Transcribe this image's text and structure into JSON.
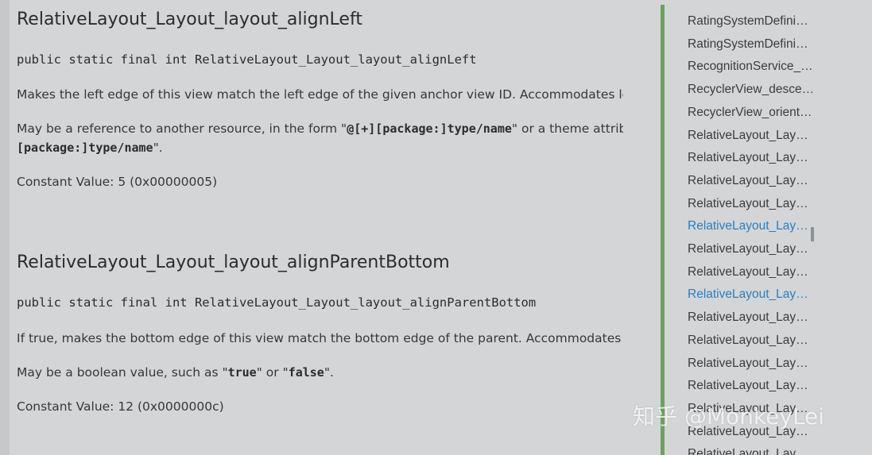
{
  "sections": [
    {
      "title": "RelativeLayout_Layout_layout_alignLeft",
      "signature": "public static final int RelativeLayout_Layout_layout_alignLeft",
      "description": "Makes the left edge of this view match the left edge of the given anchor view ID. Accommodates left margin.",
      "reference_prefix": "May be a reference to another resource, in the form \"",
      "reference_code": "@[+][package:]type/name",
      "reference_suffix": "\" or a theme attribute in the form \"",
      "reference_line2_prefix": "",
      "reference_line2_code": "[package:]type/name",
      "reference_line2_suffix": "\".",
      "constant": "Constant Value: 5 (0x00000005)"
    },
    {
      "title": "RelativeLayout_Layout_layout_alignParentBottom",
      "signature": "public static final int RelativeLayout_Layout_layout_alignParentBottom",
      "description": "If true, makes the bottom edge of this view match the bottom edge of the parent. Accommodates bottom margin.",
      "bool_prefix": "May be a boolean value, such as \"",
      "bool_true": "true",
      "bool_mid": "\" or \"",
      "bool_false": "false",
      "bool_suffix": "\".",
      "constant": "Constant Value: 12 (0x0000000c)"
    }
  ],
  "toc": {
    "items": [
      {
        "label": "RatingSystemDefini…",
        "active": false
      },
      {
        "label": "RatingSystemDefini…",
        "active": false
      },
      {
        "label": "RecognitionService_…",
        "active": false
      },
      {
        "label": "RecyclerView_desce…",
        "active": false
      },
      {
        "label": "RecyclerView_orient…",
        "active": false
      },
      {
        "label": "RelativeLayout_Lay…",
        "active": false
      },
      {
        "label": "RelativeLayout_Lay…",
        "active": false
      },
      {
        "label": "RelativeLayout_Lay…",
        "active": false
      },
      {
        "label": "RelativeLayout_Lay…",
        "active": false
      },
      {
        "label": "RelativeLayout_Lay…",
        "active": true
      },
      {
        "label": "RelativeLayout_Lay…",
        "active": false
      },
      {
        "label": "RelativeLayout_Lay…",
        "active": false
      },
      {
        "label": "RelativeLayout_Lay…",
        "active": true
      },
      {
        "label": "RelativeLayout_Lay…",
        "active": false
      },
      {
        "label": "RelativeLayout_Lay…",
        "active": false
      },
      {
        "label": "RelativeLayout_Lay…",
        "active": false
      },
      {
        "label": "RelativeLayout_Lay…",
        "active": false
      },
      {
        "label": "RelativeLayout_Lay…",
        "active": false
      },
      {
        "label": "RelativeLayout_Lay…",
        "active": false
      },
      {
        "label": "RelativeLayout_Lay…",
        "active": false
      }
    ],
    "accent_color": "#6aa35a",
    "active_color": "#2a7fc2"
  },
  "watermark": "知乎 @MonkeyLei"
}
